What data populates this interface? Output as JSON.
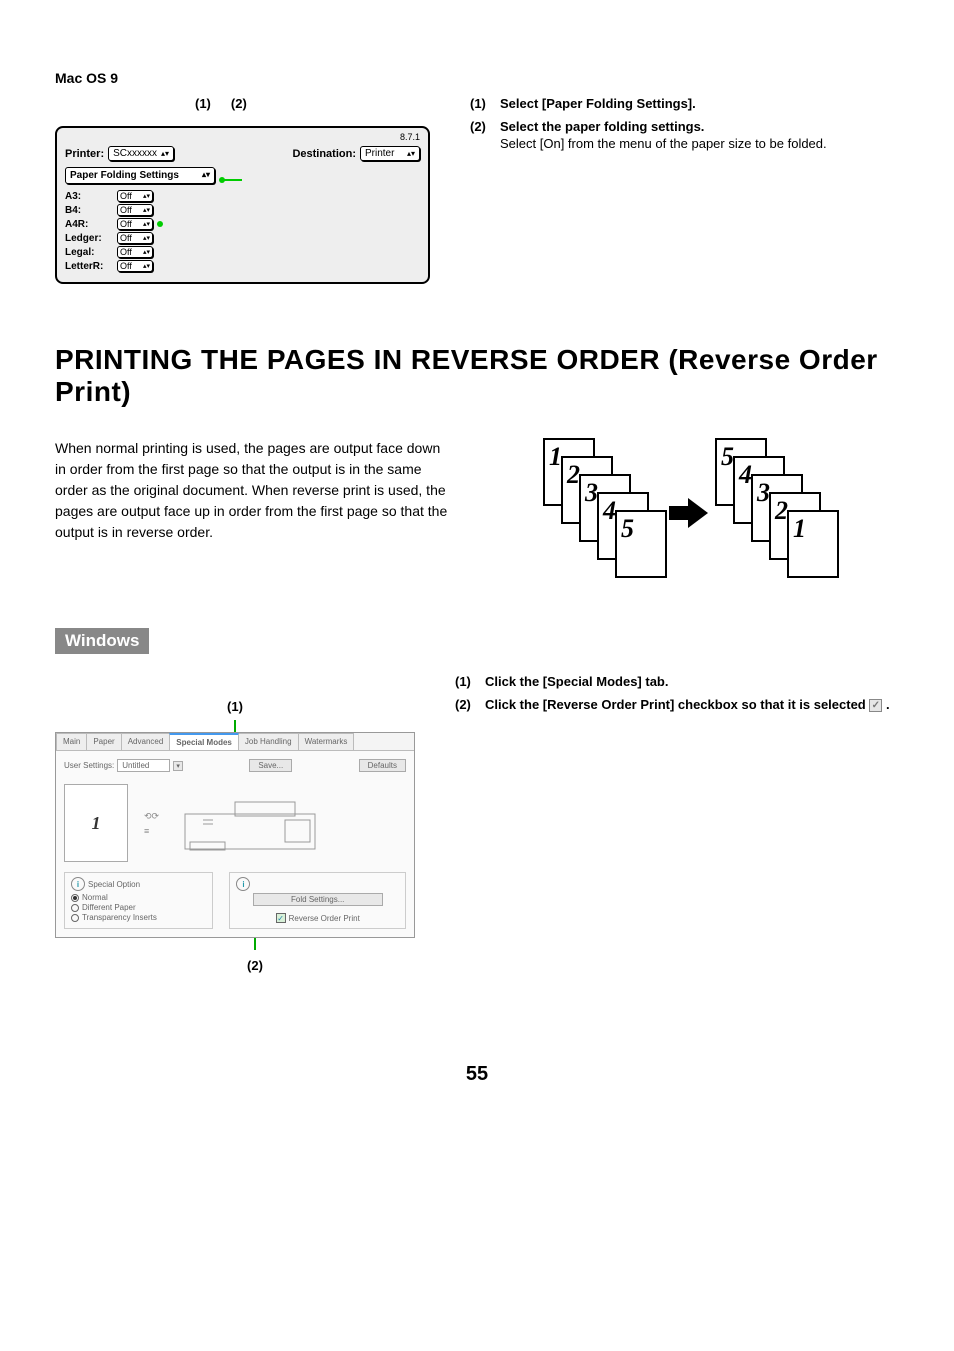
{
  "mac": {
    "os_title": "Mac OS 9",
    "callouts": {
      "c1": "(1)",
      "c2": "(2)"
    },
    "dialog": {
      "version": "8.7.1",
      "printer_label": "Printer:",
      "printer_value": "SCxxxxxx",
      "dest_label": "Destination:",
      "dest_value": "Printer",
      "section_label": "Paper Folding Settings",
      "sizes": [
        {
          "label": "A3:",
          "value": "Off"
        },
        {
          "label": "B4:",
          "value": "Off"
        },
        {
          "label": "A4R:",
          "value": "Off"
        },
        {
          "label": "Ledger:",
          "value": "Off"
        },
        {
          "label": "Legal:",
          "value": "Off"
        },
        {
          "label": "LetterR:",
          "value": "Off"
        }
      ]
    },
    "instructions": [
      {
        "num": "(1)",
        "title": "Select [Paper Folding Settings]."
      },
      {
        "num": "(2)",
        "title": "Select the paper folding settings.",
        "body": "Select [On] from the menu of the paper size to be folded."
      }
    ]
  },
  "reverse": {
    "heading": "PRINTING THE PAGES IN REVERSE ORDER (Reverse Order Print)",
    "paragraph": "When normal printing is used, the pages are output face down in order from the first page so that the output is in the same order as the original document. When reverse print is used, the pages are output face up in order from the first page so that the output is in reverse order.",
    "stack_left": [
      "1",
      "2",
      "3",
      "4",
      "5"
    ],
    "stack_right": [
      "5",
      "4",
      "3",
      "2",
      "1"
    ]
  },
  "windows": {
    "badge": "Windows",
    "callouts": {
      "top": "(1)",
      "bottom": "(2)"
    },
    "dialog": {
      "tabs": [
        "Main",
        "Paper",
        "Advanced",
        "Special Modes",
        "Job Handling",
        "Watermarks"
      ],
      "active_tab_index": 3,
      "user_settings_label": "User Settings:",
      "user_settings_value": "Untitled",
      "save_btn": "Save...",
      "defaults_btn": "Defaults",
      "preview_number": "1",
      "special_option_title": "Special Option",
      "radios": [
        {
          "label": "Normal",
          "checked": true
        },
        {
          "label": "Different Paper",
          "checked": false
        },
        {
          "label": "Transparency Inserts",
          "checked": false
        }
      ],
      "fold_btn": "Fold Settings...",
      "reverse_checkbox_label": "Reverse Order Print",
      "reverse_checked": true
    },
    "instructions": [
      {
        "num": "(1)",
        "title": "Click the [Special Modes] tab."
      },
      {
        "num": "(2)",
        "title_prefix": "Click the [Reverse Order Print] checkbox so that it is selected ",
        "title_suffix": "."
      }
    ]
  },
  "page_number": "55"
}
